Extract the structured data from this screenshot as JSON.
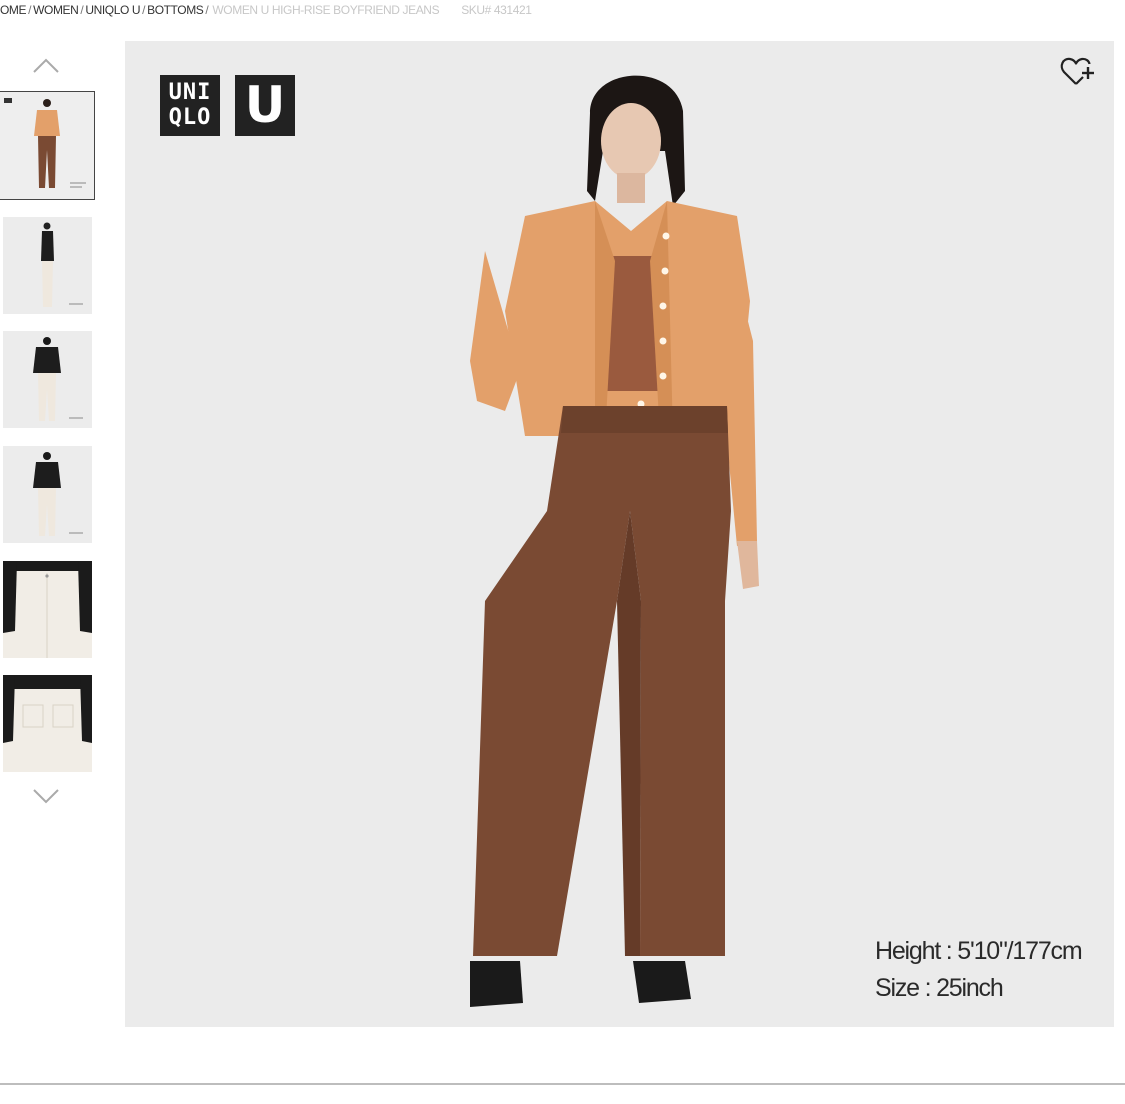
{
  "breadcrumb": {
    "items": [
      "OME",
      "WOMEN",
      "UNIQLO U",
      "BOTTOMS"
    ],
    "separator": "/",
    "current": "WOMEN U HIGH-RISE BOYFRIEND JEANS",
    "sku": "SKU# 431421"
  },
  "gallery": {
    "up_icon": "chevron-up-icon",
    "down_icon": "chevron-down-icon",
    "selected_index": 0,
    "thumbnail_count": 6
  },
  "product_image": {
    "brand_logo_lines": [
      "UNI",
      "QLO"
    ],
    "sub_brand_logo": "U",
    "favorite_icon": "heart-plus-icon",
    "model_height": "Height : 5'10\"/177cm",
    "model_size": "Size : 25inch"
  },
  "colors": {
    "shirt": "#e3a06a",
    "jeans": "#7a4a33",
    "background": "#ebebeb",
    "logo": "#222222"
  }
}
